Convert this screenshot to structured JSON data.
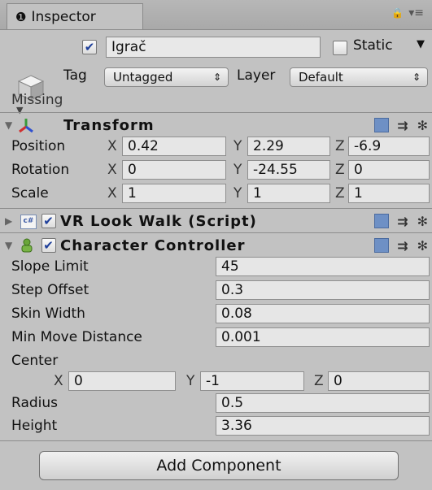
{
  "tab": {
    "label": "Inspector"
  },
  "header": {
    "name": "Igrač",
    "static_label": "Static",
    "tag_label": "Tag",
    "tag_value": "Untagged",
    "layer_label": "Layer",
    "layer_value": "Default",
    "missing": "Missing"
  },
  "transform": {
    "title": "Transform",
    "position": {
      "label": "Position",
      "x": "0.42",
      "y": "2.29",
      "z": "-6.9"
    },
    "rotation": {
      "label": "Rotation",
      "x": "0",
      "y": "-24.55",
      "z": "0"
    },
    "scale": {
      "label": "Scale",
      "x": "1",
      "y": "1",
      "z": "1"
    }
  },
  "vr_look_walk": {
    "title": "VR Look Walk (Script)",
    "icon_text": "c#"
  },
  "character_controller": {
    "title": "Character Controller",
    "slope_limit": {
      "label": "Slope Limit",
      "value": "45"
    },
    "step_offset": {
      "label": "Step Offset",
      "value": "0.3"
    },
    "skin_width": {
      "label": "Skin Width",
      "value": "0.08"
    },
    "min_move": {
      "label": "Min Move Distance",
      "value": "0.001"
    },
    "center": {
      "label": "Center",
      "x": "0",
      "y": "-1",
      "z": "0"
    },
    "radius": {
      "label": "Radius",
      "value": "0.5"
    },
    "height": {
      "label": "Height",
      "value": "3.36"
    }
  },
  "axes": {
    "x": "X",
    "y": "Y",
    "z": "Z"
  },
  "add_component": "Add Component",
  "glyphs": {
    "info": "❶",
    "lock": "🔒",
    "menu": "▾≡",
    "check": "✔",
    "fold_down": "▼",
    "fold_right": "▶",
    "dd_arrow": "⇕",
    "sliders": "⇉",
    "gear": "✻"
  }
}
